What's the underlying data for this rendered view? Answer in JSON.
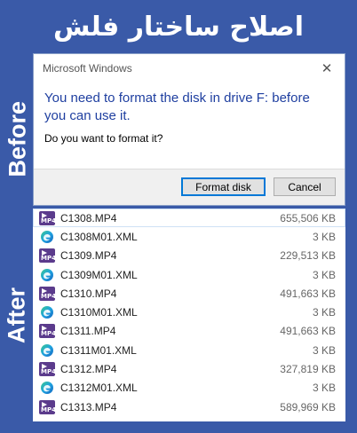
{
  "banner": {
    "title": "اصلاح ساختار فلش"
  },
  "labels": {
    "before": "Before",
    "after": "After"
  },
  "dialog": {
    "title": "Microsoft Windows",
    "close_glyph": "✕",
    "message": "You need to format the disk in drive F: before you can use it.",
    "question": "Do you want to format it?",
    "format_label": "Format disk",
    "cancel_label": "Cancel"
  },
  "files": [
    {
      "name": "C1308.MP4",
      "size": "655,506 KB",
      "type": "mp4",
      "selected": true
    },
    {
      "name": "C1308M01.XML",
      "size": "3 KB",
      "type": "xml"
    },
    {
      "name": "C1309.MP4",
      "size": "229,513 KB",
      "type": "mp4"
    },
    {
      "name": "C1309M01.XML",
      "size": "3 KB",
      "type": "xml"
    },
    {
      "name": "C1310.MP4",
      "size": "491,663 KB",
      "type": "mp4"
    },
    {
      "name": "C1310M01.XML",
      "size": "3 KB",
      "type": "xml"
    },
    {
      "name": "C1311.MP4",
      "size": "491,663 KB",
      "type": "mp4"
    },
    {
      "name": "C1311M01.XML",
      "size": "3 KB",
      "type": "xml"
    },
    {
      "name": "C1312.MP4",
      "size": "327,819 KB",
      "type": "mp4"
    },
    {
      "name": "C1312M01.XML",
      "size": "3 KB",
      "type": "xml"
    },
    {
      "name": "C1313.MP4",
      "size": "589,969 KB",
      "type": "mp4"
    }
  ],
  "colors": {
    "background": "#3a5aa8",
    "dialog_text": "#1f3fa0",
    "mp4_icon": "#5b3b8c"
  },
  "icons": {
    "mp4": "mp4-file-icon",
    "xml": "edge-xml-file-icon"
  }
}
